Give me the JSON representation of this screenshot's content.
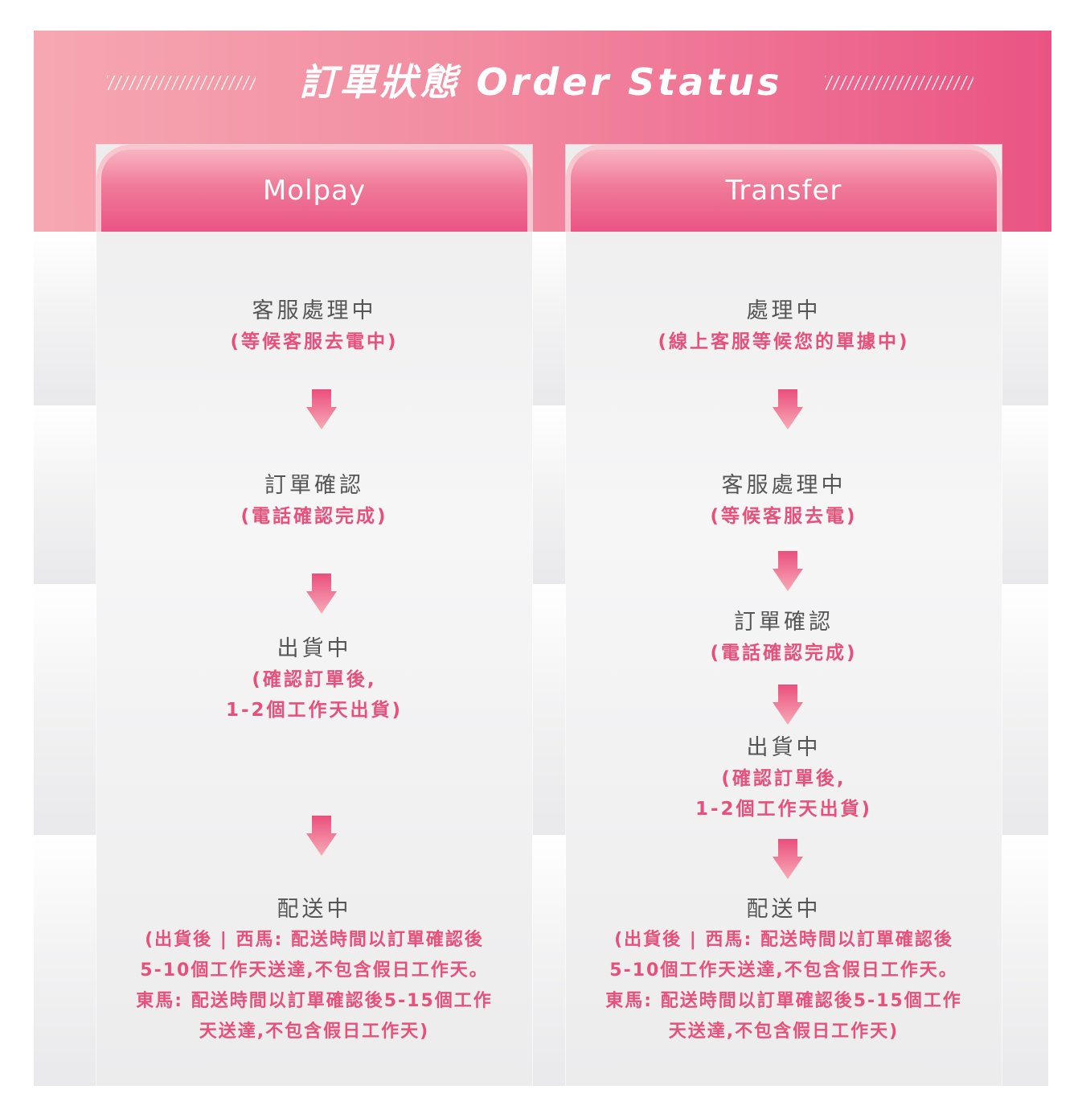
{
  "header": {
    "title": "訂單狀態 Order Status"
  },
  "colors": {
    "pink_accent": "#e8507c",
    "banner_start": "#f6a8b2",
    "banner_end": "#ea5484",
    "step_title": "#555555",
    "background_gray": "#ededee"
  },
  "columns": [
    {
      "name": "Molpay",
      "steps": [
        {
          "title": "客服處理中",
          "desc": "(等候客服去電中)"
        },
        {
          "title": "訂單確認",
          "desc": "(電話確認完成)"
        },
        {
          "title": "出貨中",
          "desc": "(確認訂單後,\n1-2個工作天出貨)"
        },
        {
          "title": "配送中",
          "desc": "(出貨後 | 西馬: 配送時間以訂單確認後\n5-10個工作天送達,不包含假日工作天。\n東馬: 配送時間以訂單確認後5-15個工作\n天送達,不包含假日工作天)"
        }
      ]
    },
    {
      "name": "Transfer",
      "steps": [
        {
          "title": "處理中",
          "desc": "(線上客服等候您的單據中)"
        },
        {
          "title": "客服處理中",
          "desc": "(等候客服去電)"
        },
        {
          "title": "訂單確認",
          "desc": "(電話確認完成)"
        },
        {
          "title": "出貨中",
          "desc": "(確認訂單後,\n1-2個工作天出貨)"
        },
        {
          "title": "配送中",
          "desc": "(出貨後 | 西馬: 配送時間以訂單確認後\n5-10個工作天送達,不包含假日工作天。\n東馬: 配送時間以訂單確認後5-15個工作\n天送達,不包含假日工作天)"
        }
      ]
    }
  ],
  "icons": {
    "arrow": "arrow-down-icon",
    "deco": "slash-pattern-icon"
  }
}
